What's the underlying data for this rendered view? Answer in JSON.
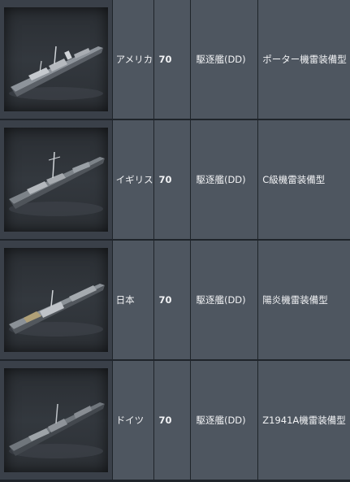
{
  "rows": [
    {
      "nation": "アメリカ",
      "tier": "70",
      "type": "駆逐艦(DD)",
      "name": "ポーター機雷装備型",
      "image": "ship-porter-image"
    },
    {
      "nation": "イギリス",
      "tier": "70",
      "type": "駆逐艦(DD)",
      "name": "C級機雷装備型",
      "image": "ship-c-class-image"
    },
    {
      "nation": "日本",
      "tier": "70",
      "type": "駆逐艦(DD)",
      "name": "陽炎機雷装備型",
      "image": "ship-kagero-image"
    },
    {
      "nation": "ドイツ",
      "tier": "70",
      "type": "駆逐艦(DD)",
      "name": "Z1941A機雷装備型",
      "image": "ship-z1941a-image"
    }
  ]
}
